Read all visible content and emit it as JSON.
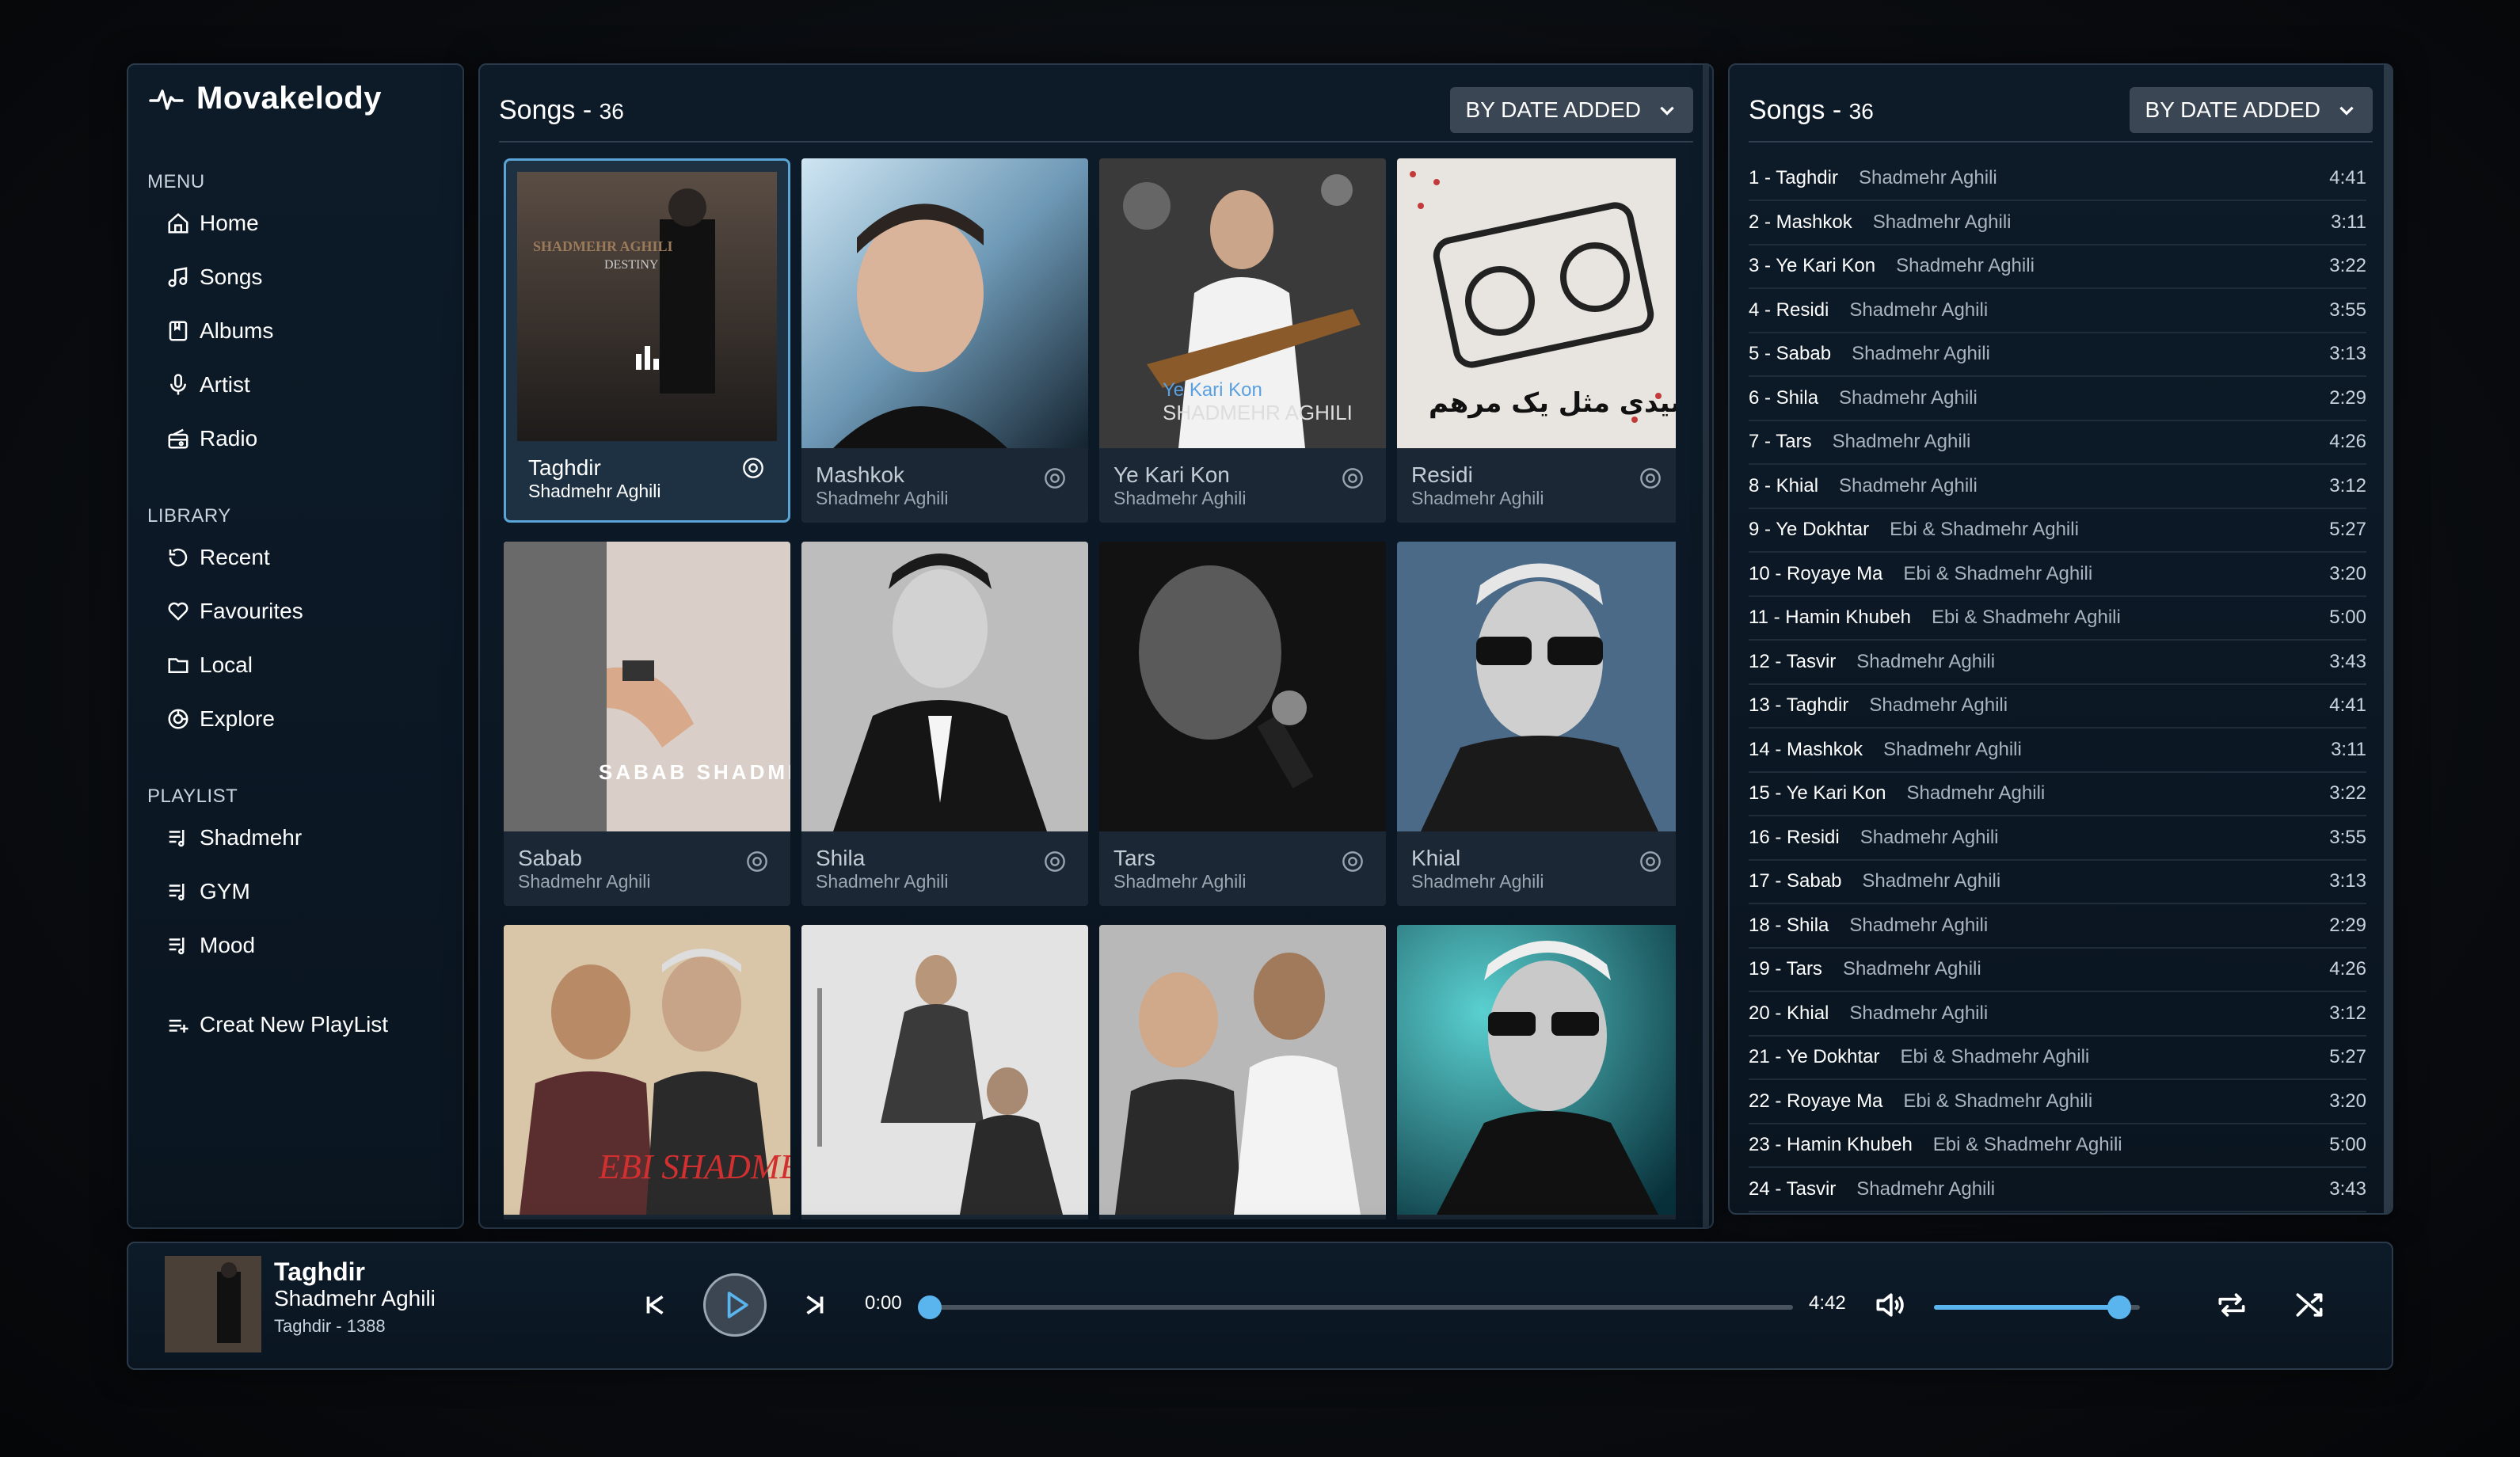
{
  "app": {
    "name": "Movakelody"
  },
  "sidebar": {
    "menu_title": "MENU",
    "menu": [
      {
        "label": "Home",
        "icon": "home-icon"
      },
      {
        "label": "Songs",
        "icon": "music-note-icon"
      },
      {
        "label": "Albums",
        "icon": "album-icon"
      },
      {
        "label": "Artist",
        "icon": "microphone-icon"
      },
      {
        "label": "Radio",
        "icon": "radio-icon"
      }
    ],
    "library_title": "LIBRARY",
    "library": [
      {
        "label": "Recent",
        "icon": "recent-icon"
      },
      {
        "label": "Favourites",
        "icon": "heart-icon"
      },
      {
        "label": "Local",
        "icon": "folder-icon"
      },
      {
        "label": "Explore",
        "icon": "explore-icon"
      }
    ],
    "playlist_title": "PLAYLIST",
    "playlists": [
      {
        "label": "Shadmehr",
        "icon": "playlist-icon"
      },
      {
        "label": "GYM",
        "icon": "playlist-icon"
      },
      {
        "label": "Mood",
        "icon": "playlist-icon"
      }
    ],
    "create_playlist": "Creat New PlayList"
  },
  "main": {
    "title": "Songs - ",
    "count": "36",
    "sort_label": "BY DATE ADDED",
    "cards": [
      {
        "title": "Taghdir",
        "artist": "Shadmehr Aghili",
        "selected": true,
        "cover_text": "SHADMEHR AGHILI DESTINY"
      },
      {
        "title": "Mashkok",
        "artist": "Shadmehr Aghili"
      },
      {
        "title": "Ye Kari Kon",
        "artist": "Shadmehr Aghili",
        "cover_text": "Ye Kari Kon"
      },
      {
        "title": "Residi",
        "artist": "Shadmehr Aghili",
        "cover_text": "رسیدی مثل یک مرهم"
      },
      {
        "title": "Sabab",
        "artist": "Shadmehr Aghili",
        "cover_text": "SABAB SHADMEHR"
      },
      {
        "title": "Shila",
        "artist": "Shadmehr Aghili"
      },
      {
        "title": "Tars",
        "artist": "Shadmehr Aghili"
      },
      {
        "title": "Khial",
        "artist": "Shadmehr Aghili"
      },
      {
        "title": "",
        "artist": "",
        "cover_text": "EBI SHADMEHR"
      },
      {
        "title": "",
        "artist": ""
      },
      {
        "title": "",
        "artist": ""
      },
      {
        "title": "",
        "artist": ""
      }
    ]
  },
  "list": {
    "title": "Songs - ",
    "count": "36",
    "sort_label": "BY DATE ADDED",
    "rows": [
      {
        "label": "1 - Taghdir",
        "artist": "Shadmehr Aghili",
        "duration": "4:41"
      },
      {
        "label": "2 - Mashkok",
        "artist": "Shadmehr Aghili",
        "duration": "3:11"
      },
      {
        "label": "3 - Ye Kari Kon",
        "artist": "Shadmehr Aghili",
        "duration": "3:22"
      },
      {
        "label": "4 - Residi",
        "artist": "Shadmehr Aghili",
        "duration": "3:55"
      },
      {
        "label": "5 - Sabab",
        "artist": "Shadmehr Aghili",
        "duration": "3:13"
      },
      {
        "label": "6 - Shila",
        "artist": "Shadmehr Aghili",
        "duration": "2:29"
      },
      {
        "label": "7 - Tars",
        "artist": "Shadmehr Aghili",
        "duration": "4:26"
      },
      {
        "label": "8 - Khial",
        "artist": "Shadmehr Aghili",
        "duration": "3:12"
      },
      {
        "label": "9 - Ye Dokhtar",
        "artist": "Ebi & Shadmehr Aghili",
        "duration": "5:27"
      },
      {
        "label": "10 - Royaye Ma",
        "artist": "Ebi & Shadmehr Aghili",
        "duration": "3:20"
      },
      {
        "label": "11 - Hamin Khubeh",
        "artist": "Ebi & Shadmehr Aghili",
        "duration": "5:00"
      },
      {
        "label": "12 - Tasvir",
        "artist": "Shadmehr Aghili",
        "duration": "3:43"
      },
      {
        "label": "13 - Taghdir",
        "artist": "Shadmehr Aghili",
        "duration": "4:41"
      },
      {
        "label": "14 - Mashkok",
        "artist": "Shadmehr Aghili",
        "duration": "3:11"
      },
      {
        "label": "15 - Ye Kari Kon",
        "artist": "Shadmehr Aghili",
        "duration": "3:22"
      },
      {
        "label": "16 - Residi",
        "artist": "Shadmehr Aghili",
        "duration": "3:55"
      },
      {
        "label": "17 - Sabab",
        "artist": "Shadmehr Aghili",
        "duration": "3:13"
      },
      {
        "label": "18 - Shila",
        "artist": "Shadmehr Aghili",
        "duration": "2:29"
      },
      {
        "label": "19 - Tars",
        "artist": "Shadmehr Aghili",
        "duration": "4:26"
      },
      {
        "label": "20 - Khial",
        "artist": "Shadmehr Aghili",
        "duration": "3:12"
      },
      {
        "label": "21 - Ye Dokhtar",
        "artist": "Ebi & Shadmehr Aghili",
        "duration": "5:27"
      },
      {
        "label": "22 - Royaye Ma",
        "artist": "Ebi & Shadmehr Aghili",
        "duration": "3:20"
      },
      {
        "label": "23 - Hamin Khubeh",
        "artist": "Ebi & Shadmehr Aghili",
        "duration": "5:00"
      },
      {
        "label": "24 - Tasvir",
        "artist": "Shadmehr Aghili",
        "duration": "3:43"
      }
    ]
  },
  "player": {
    "title": "Taghdir",
    "artist": "Shadmehr Aghili",
    "album": "Taghdir - 1388",
    "elapsed": "0:00",
    "total": "4:42",
    "progress": 0.0,
    "volume": 0.9,
    "accent": "#5ab4ee"
  }
}
